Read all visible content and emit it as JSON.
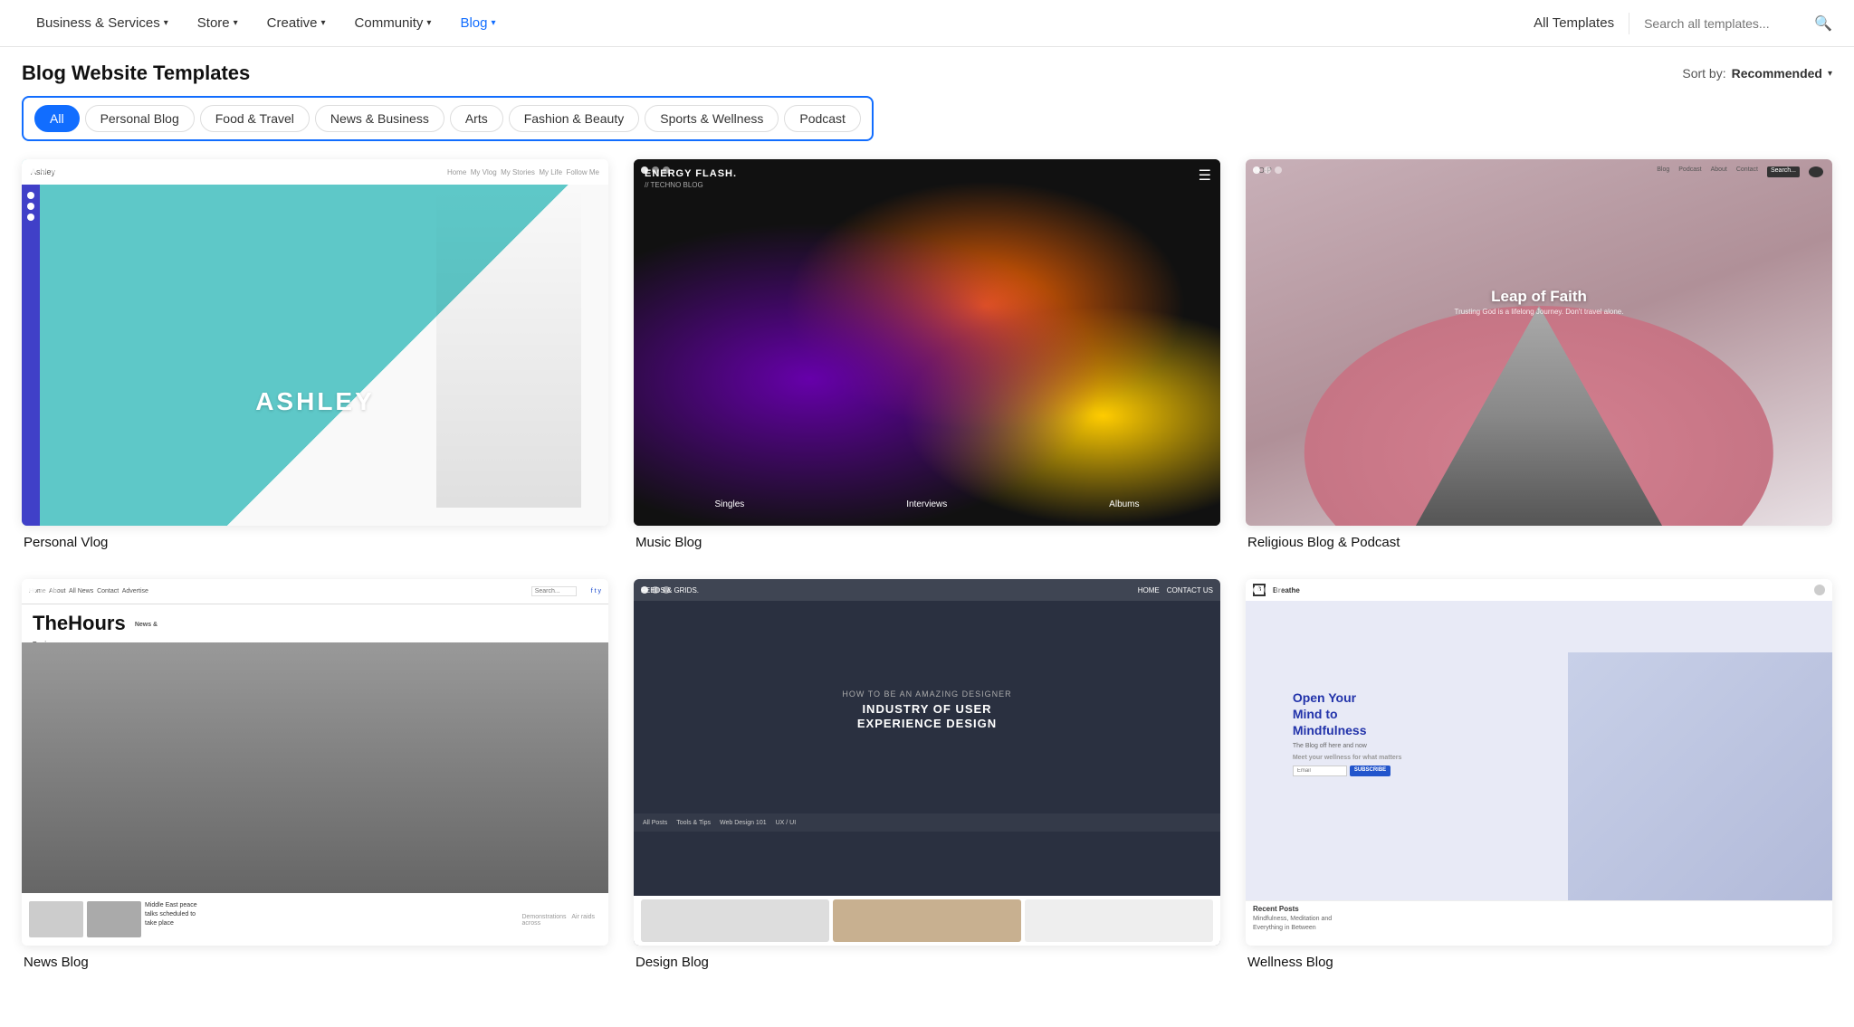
{
  "nav": {
    "items": [
      {
        "label": "Business & Services",
        "id": "business-services",
        "active": false
      },
      {
        "label": "Store",
        "id": "store",
        "active": false
      },
      {
        "label": "Creative",
        "id": "creative",
        "active": false
      },
      {
        "label": "Community",
        "id": "community",
        "active": false
      },
      {
        "label": "Blog",
        "id": "blog",
        "active": true
      }
    ],
    "right": {
      "all_templates": "All Templates",
      "search_placeholder": "Search all templates..."
    }
  },
  "page": {
    "title": "Blog Website Templates",
    "sort_label": "Sort by:",
    "sort_value": "Recommended"
  },
  "filters": {
    "tabs": [
      {
        "label": "All",
        "id": "all",
        "active": true
      },
      {
        "label": "Personal Blog",
        "id": "personal-blog",
        "active": false
      },
      {
        "label": "Food & Travel",
        "id": "food-travel",
        "active": false
      },
      {
        "label": "News & Business",
        "id": "news-business",
        "active": false
      },
      {
        "label": "Arts",
        "id": "arts",
        "active": false
      },
      {
        "label": "Fashion & Beauty",
        "id": "fashion-beauty",
        "active": false
      },
      {
        "label": "Sports & Wellness",
        "id": "sports-wellness",
        "active": false
      },
      {
        "label": "Podcast",
        "id": "podcast",
        "active": false
      }
    ]
  },
  "templates": [
    {
      "id": "personal-vlog",
      "name": "Personal Vlog",
      "type": "ashley"
    },
    {
      "id": "music-blog",
      "name": "Music Blog",
      "type": "energy"
    },
    {
      "id": "religious-blog-podcast",
      "name": "Religious Blog & Podcast",
      "type": "leap"
    },
    {
      "id": "news-blog",
      "name": "News Blog",
      "type": "hours"
    },
    {
      "id": "design-blog",
      "name": "Design Blog",
      "type": "design"
    },
    {
      "id": "wellness-blog",
      "name": "Wellness Blog",
      "type": "wellness"
    }
  ]
}
